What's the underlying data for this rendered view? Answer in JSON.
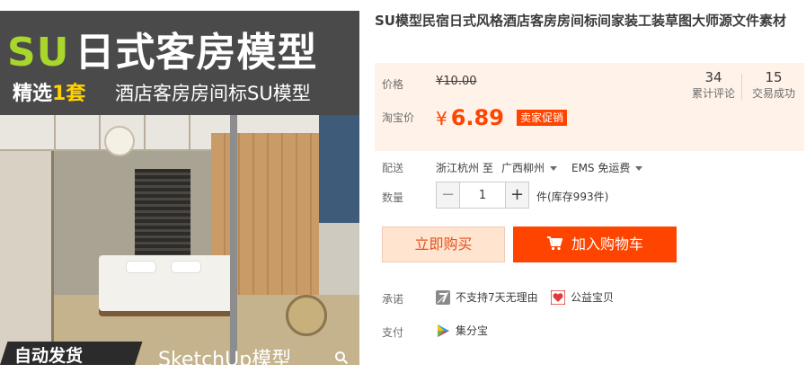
{
  "gallery": {
    "banner_title_su": "SU",
    "banner_title_rest": "日式客房模型",
    "banner_sub_pre": "精选",
    "banner_sub_hl": "1套",
    "banner_sub2": "酒店客房房间标SU模型",
    "tag_auto": "自动发货",
    "tag_sketch": "SketchUp模型"
  },
  "product": {
    "title": "SU模型民宿日式风格酒店客房房间标间家装工装草图大师源文件素材"
  },
  "price": {
    "label": "价格",
    "original": "¥10.00",
    "original_currency": "¥",
    "original_value": "10.00",
    "promo_label": "淘宝价",
    "promo_currency": "¥",
    "promo_value": "6.89",
    "promo_badge": "卖家促销"
  },
  "stats": {
    "reviews_count": "34",
    "reviews_label": "累计评论",
    "sales_count": "15",
    "sales_label": "交易成功"
  },
  "shipping": {
    "label": "配送",
    "from": "浙江杭州 至",
    "to": "广西柳州",
    "method": "EMS 免运费"
  },
  "quantity": {
    "label": "数量",
    "value": "1",
    "minus": "−",
    "plus": "+",
    "stock": "件(库存993件)"
  },
  "actions": {
    "buy_now": "立即购买",
    "add_to_cart": "加入购物车"
  },
  "promise": {
    "label": "承诺",
    "items": [
      "不支持7天无理由",
      "公益宝贝"
    ]
  },
  "payment": {
    "label": "支付",
    "method": "集分宝"
  },
  "colors": {
    "accent": "#ff4400",
    "price_bg": "#fff2e8",
    "su_green": "#a8d62b",
    "highlight_yellow": "#ffd200"
  }
}
